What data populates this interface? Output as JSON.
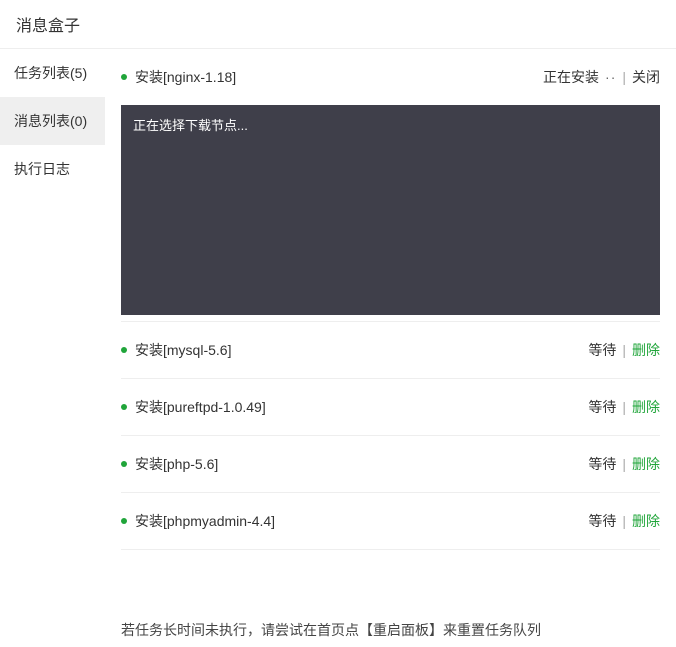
{
  "header": {
    "title": "消息盒子"
  },
  "sidebar": {
    "items": [
      {
        "label": "任务列表(5)"
      },
      {
        "label": "消息列表(0)"
      },
      {
        "label": "执行日志"
      }
    ]
  },
  "tasks": {
    "running": {
      "name": "安装[nginx-1.18]",
      "status": "正在安装",
      "spinner": "··",
      "close": "关闭",
      "console": "正在选择下载节点..."
    },
    "queued": [
      {
        "name": "安装[mysql-5.6]",
        "status": "等待",
        "action": "删除"
      },
      {
        "name": "安装[pureftpd-1.0.49]",
        "status": "等待",
        "action": "删除"
      },
      {
        "name": "安装[php-5.6]",
        "status": "等待",
        "action": "删除"
      },
      {
        "name": "安装[phpmyadmin-4.4]",
        "status": "等待",
        "action": "删除"
      }
    ]
  },
  "footer": {
    "note": "若任务长时间未执行，请尝试在首页点【重启面板】来重置任务队列"
  }
}
